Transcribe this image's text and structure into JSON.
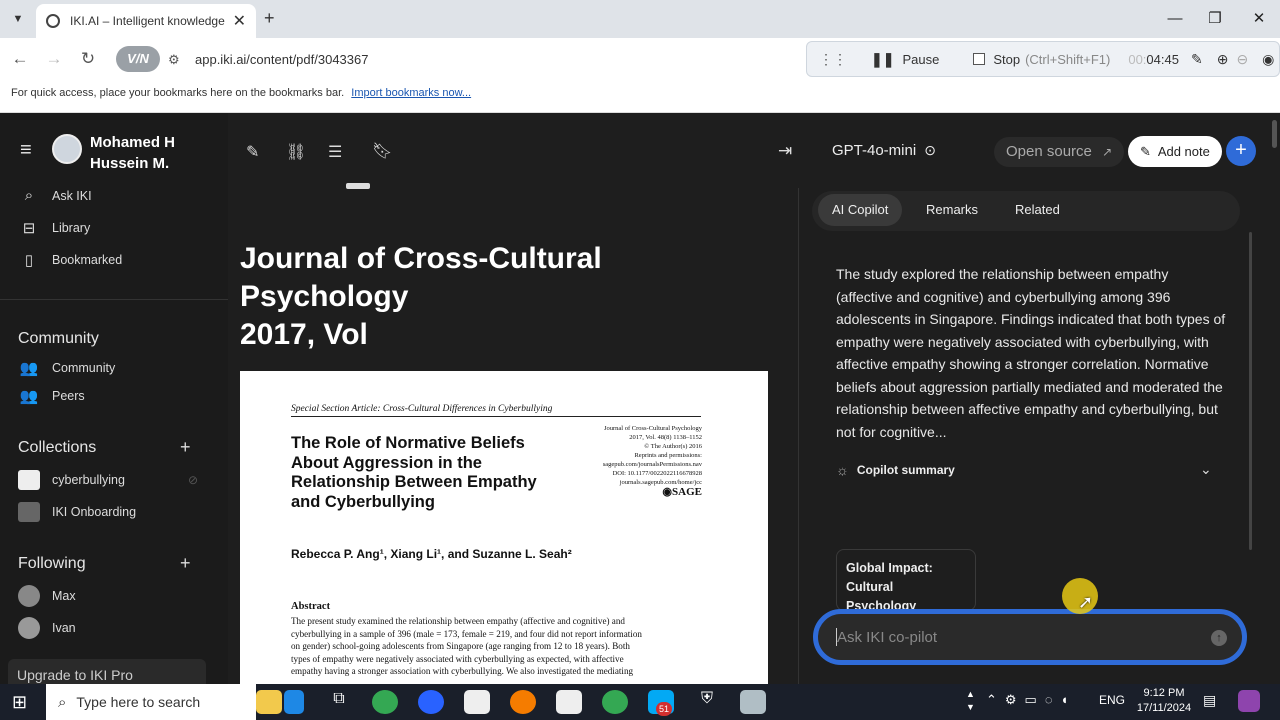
{
  "browser": {
    "tab_title": "IKI.AI – Intelligent knowledge Ir",
    "new_tab": "+",
    "url": "app.iki.ai/content/pdf/3043367",
    "vpn_badge": "V/N",
    "bookmarks_text": "For quick access, place your bookmarks here on the bookmarks bar.",
    "bookmarks_link": "Import bookmarks now..."
  },
  "recorder": {
    "pause_label": "Pause",
    "stop_label": "Stop",
    "stop_hint": "(Ctrl+Shift+F1)",
    "time_prefix": "00:",
    "time": "04:45"
  },
  "sidebar": {
    "user_name_line1": "Mohamed H",
    "user_name_line2": "Hussein M.",
    "nav": [
      {
        "label": "Ask IKI",
        "icon": "search-icon"
      },
      {
        "label": "Library",
        "icon": "library-icon"
      },
      {
        "label": "Bookmarked",
        "icon": "bookmark-icon"
      }
    ],
    "community_header": "Community",
    "community_items": [
      {
        "label": "Community",
        "icon": "people-icon"
      },
      {
        "label": "Peers",
        "icon": "peers-icon"
      }
    ],
    "collections_header": "Collections",
    "collections": [
      {
        "label": "cyberbullying"
      },
      {
        "label": "IKI Onboarding"
      }
    ],
    "following_header": "Following",
    "following": [
      {
        "label": "Max"
      },
      {
        "label": "Ivan"
      }
    ],
    "upgrade_label": "Upgrade to IKI Pro"
  },
  "document": {
    "title_line1": "Journal of Cross-Cultural",
    "title_line2": "Psychology",
    "title_line3": "2017, Vol",
    "paper": {
      "section": "Special Section Article: Cross-Cultural Differences in Cyberbullying",
      "journal_info": [
        "Journal of Cross-Cultural Psychology",
        "2017, Vol. 48(8) 1138–1152",
        "© The Author(s) 2016",
        "Reprints and permissions:",
        "sagepub.com/journalsPermissions.nav",
        "DOI: 10.1177/0022022116678928",
        "journals.sagepub.com/home/jcc"
      ],
      "publisher": "SAGE",
      "title_lines": [
        "The Role of Normative Beliefs",
        "About Aggression in the",
        "Relationship Between Empathy",
        "and Cyberbullying"
      ],
      "authors": "Rebecca P. Ang¹, Xiang Li¹, and Suzanne L. Seah²",
      "abstract_heading": "Abstract",
      "abstract_lines": [
        "The present study examined the relationship between empathy (affective and cognitive) and",
        "cyberbullying in a sample of 396 (male = 173, female = 219, and four did not report information",
        "on gender) school-going adolescents from Singapore (age ranging from 12 to 18 years). Both",
        "types of empathy were negatively associated with cyberbullying as expected, with affective",
        "empathy having a stronger association with cyberbullying. We also investigated the mediating"
      ]
    }
  },
  "right_panel": {
    "model": "GPT-4o-mini",
    "open_source": "Open source",
    "add_note": "Add note",
    "tabs": [
      "AI Copilot",
      "Remarks",
      "Related"
    ],
    "summary": "The study explored the relationship between empathy (affective and cognitive) and cyberbullying among 396 adolescents in Singapore. Findings indicated that both types of empathy were negatively associated with cyberbullying, with affective empathy showing a stronger correlation. Normative beliefs about aggression partially mediated and moderated the relationship between affective empathy and cyberbullying, but not for cognitive...",
    "summary_label": "Copilot summary",
    "card_title_line1": "Global Impact:",
    "card_title_line2": "Cultural Psychology",
    "ask_placeholder": "Ask IKI co-pilot"
  },
  "taskbar": {
    "search_placeholder": "Type here to search",
    "lang": "ENG",
    "time": "9:12 PM",
    "date": "17/11/2024",
    "badge": "51"
  },
  "colors": {
    "accent_blue": "#2f6bd8",
    "app_bg": "#1e1e1e",
    "sidebar_bg": "#1b1b1b"
  }
}
